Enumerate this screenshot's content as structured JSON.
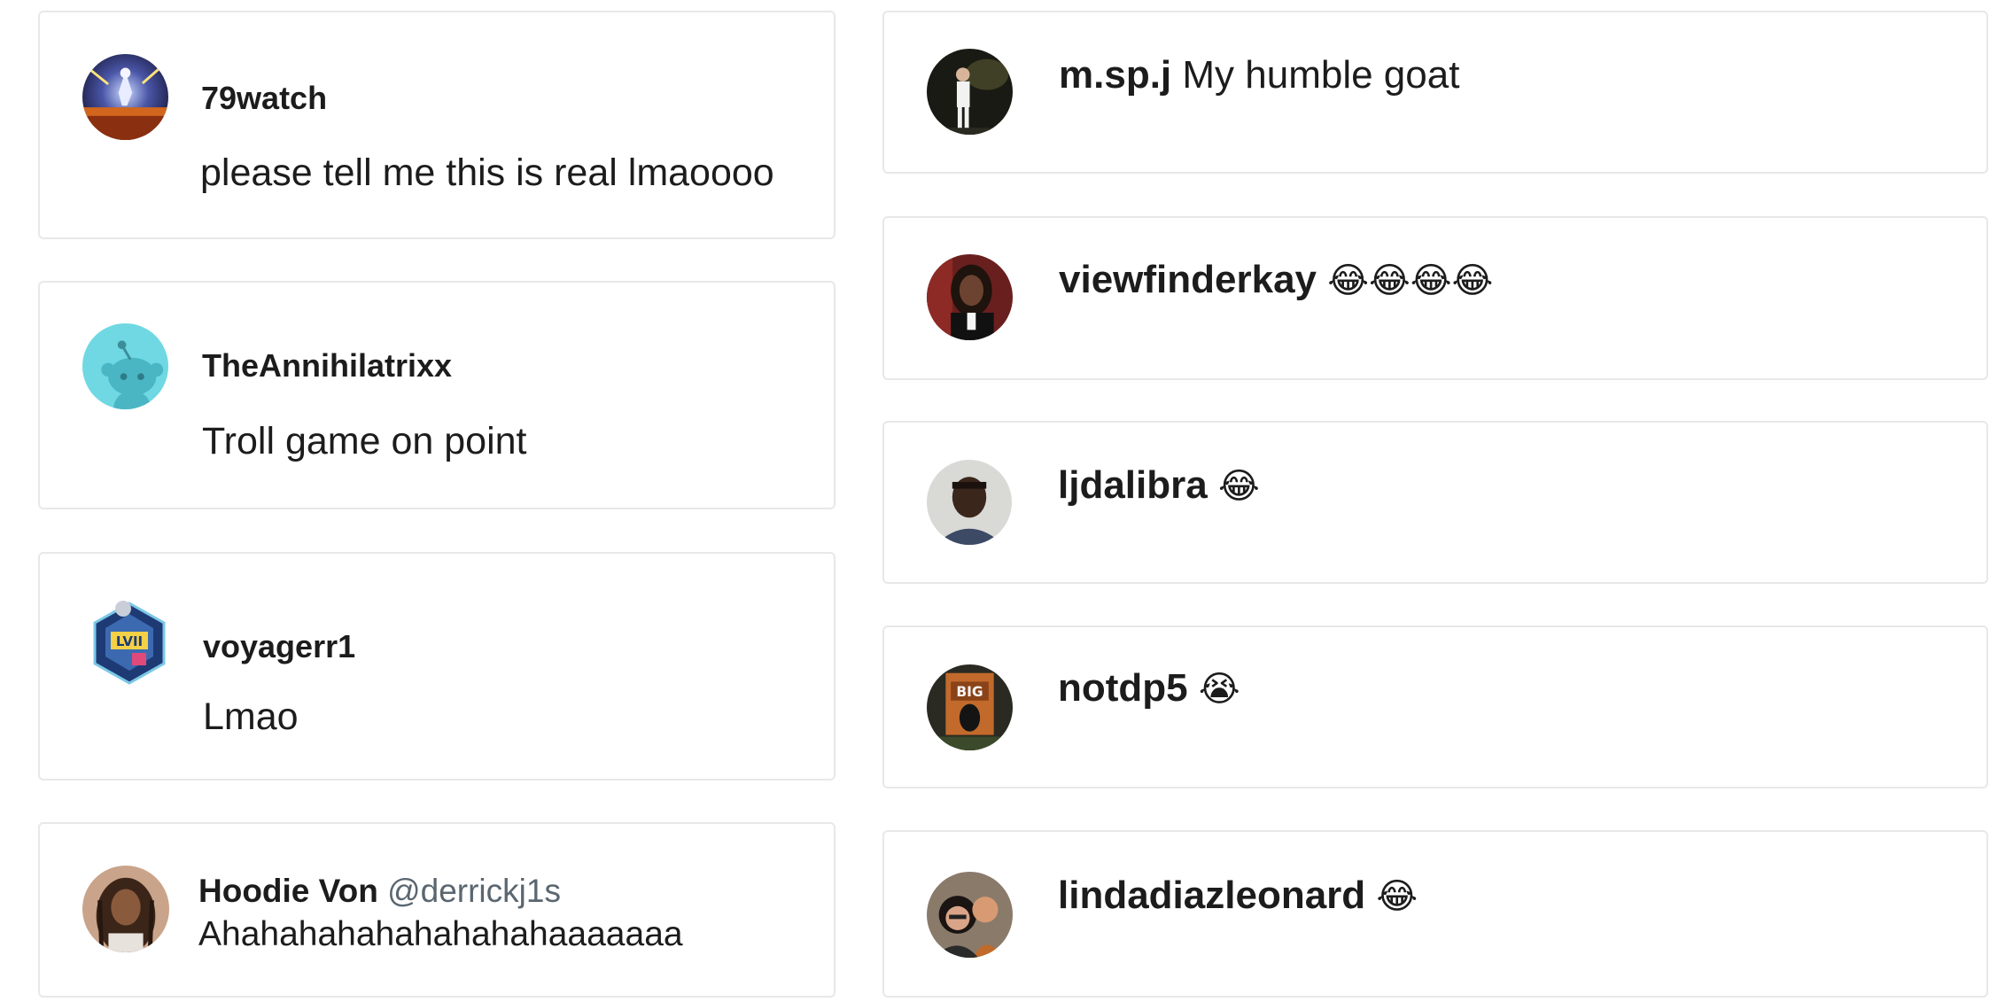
{
  "left_column": {
    "comments": [
      {
        "username": "79watch",
        "text": "please tell me this is real lmaoooo",
        "avatar_icon": "avatar-gaming-art-icon"
      },
      {
        "username": "TheAnnihilatrixx",
        "text": "Troll game on point",
        "avatar_icon": "avatar-reddit-snoo-icon"
      },
      {
        "username": "voyagerr1",
        "text": "Lmao",
        "avatar_icon": "avatar-hexagon-badge-icon"
      },
      {
        "username": "Hoodie Von",
        "handle": "@derrickj1s",
        "text": "Ahahahahahahahahahaaaaaaa",
        "avatar_icon": "avatar-person-icon"
      }
    ]
  },
  "right_column": {
    "comments": [
      {
        "username": "m.sp.j",
        "text": "My humble goat",
        "avatar_icon": "avatar-person-stage-icon"
      },
      {
        "username": "viewfinderkay",
        "text": "😂😂😂😂",
        "avatar_icon": "avatar-person-icon"
      },
      {
        "username": "ljdalibra",
        "text": "😂",
        "avatar_icon": "avatar-person-icon"
      },
      {
        "username": "notdp5",
        "text": "😭",
        "avatar_icon": "avatar-person-chair-icon"
      },
      {
        "username": "lindadiazleonard",
        "text": "😂",
        "avatar_icon": "avatar-couple-icon"
      }
    ]
  }
}
